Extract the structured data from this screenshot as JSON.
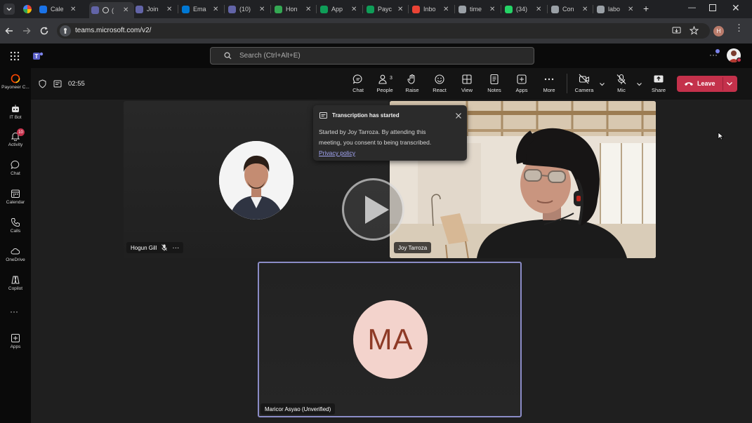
{
  "browser": {
    "tabs": [
      {
        "label": "Cale",
        "color": "#1a73e8"
      },
      {
        "label": "(",
        "color": "#6264a7",
        "active": true
      },
      {
        "label": "Join",
        "color": "#6264a7"
      },
      {
        "label": "Ema",
        "color": "#0078d4"
      },
      {
        "label": "(10)",
        "color": "#6264a7"
      },
      {
        "label": "Hon",
        "color": "#34a853"
      },
      {
        "label": "App",
        "color": "#0f9d58"
      },
      {
        "label": "Payc",
        "color": "#0f9d58"
      },
      {
        "label": "Inbo",
        "color": "#ea4335"
      },
      {
        "label": "time",
        "color": "#9aa0a6"
      },
      {
        "label": "(34)",
        "color": "#25d366"
      },
      {
        "label": "Con",
        "color": "#9aa0a6"
      },
      {
        "label": "labo",
        "color": "#9aa0a6"
      }
    ],
    "url": "teams.microsoft.com/v2/",
    "profile_initial": "H"
  },
  "teams": {
    "search_placeholder": "Search (Ctrl+Alt+E)"
  },
  "rail": {
    "items": [
      {
        "label": "Payoneer C..."
      },
      {
        "label": "IT Bot"
      },
      {
        "label": "Activity",
        "badge": "10"
      },
      {
        "label": "Chat"
      },
      {
        "label": "Calendar"
      },
      {
        "label": "Calls"
      },
      {
        "label": "OneDrive"
      },
      {
        "label": "Copilot"
      },
      {
        "label": "Apps"
      }
    ]
  },
  "meeting": {
    "timer": "02:55",
    "controls": {
      "chat": "Chat",
      "people": "People",
      "people_count": "3",
      "raise": "Raise",
      "react": "React",
      "view": "View",
      "notes": "Notes",
      "apps": "Apps",
      "more": "More",
      "camera": "Camera",
      "mic": "Mic",
      "share": "Share",
      "leave": "Leave"
    },
    "toast": {
      "title": "Transcription has started",
      "body_line1": "Started by Joy Tarroza. By attending this",
      "body_line2": "meeting, you consent to being transcribed.",
      "link": "Privacy policy"
    },
    "participants": [
      {
        "name": "Hogun Gill"
      },
      {
        "name": "Joy Tarroza"
      },
      {
        "name": "Maricor Asyao (Unverified)",
        "initials": "MA",
        "avatar_color": "#f3d3cc",
        "initials_color": "#8e3a26",
        "border_color": "#8b8cc7"
      }
    ]
  }
}
